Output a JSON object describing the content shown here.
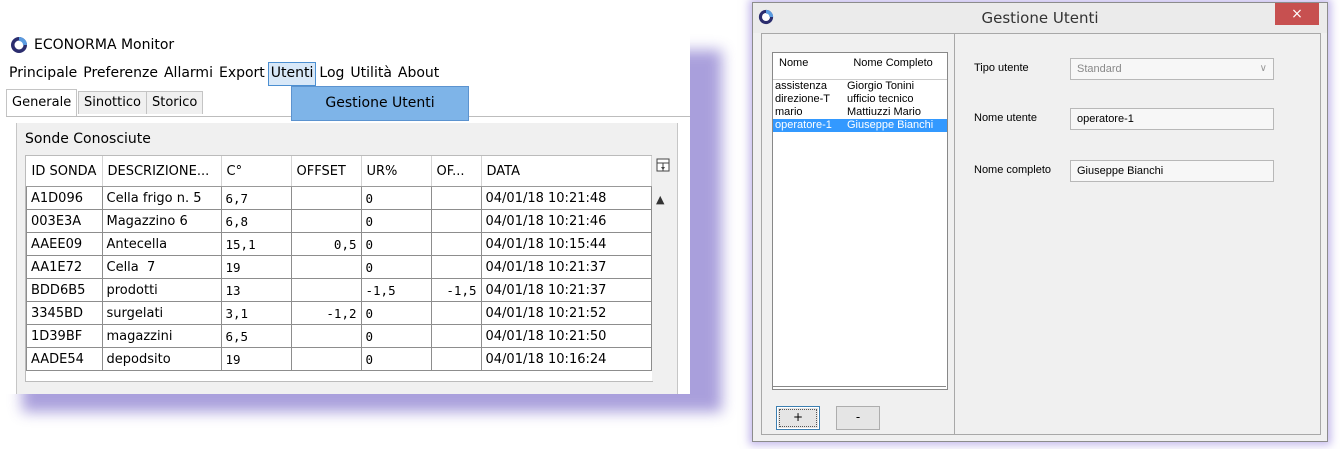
{
  "app": {
    "title": "ECONORMA Monitor"
  },
  "menu": [
    "Principale",
    "Preferenze",
    "Allarmi",
    "Export",
    "Utenti",
    "Log",
    "Utilità",
    "About"
  ],
  "tabs": [
    "Generale",
    "Sinottico",
    "Storico"
  ],
  "dropdown": {
    "item": "Gestione Utenti"
  },
  "panel": {
    "title": "Sonde Conosciute"
  },
  "grid": {
    "columns": [
      "ID SONDA",
      "DESCRIZIONE...",
      "C°",
      "OFFSET",
      "UR%",
      "OF...",
      "DATA"
    ],
    "rows": [
      [
        "A1D096",
        "Cella frigo n. 5",
        "6,7",
        "",
        "0",
        "",
        "04/01/18 10:21:48"
      ],
      [
        "003E3A",
        "Magazzino 6",
        "6,8",
        "",
        "0",
        "",
        "04/01/18 10:21:46"
      ],
      [
        "AAEE09",
        "Antecella",
        "15,1",
        "0,5",
        "0",
        "",
        "04/01/18 10:15:44"
      ],
      [
        "AA1E72",
        "Cella  7",
        "19",
        "",
        "0",
        "",
        "04/01/18 10:21:37"
      ],
      [
        "BDD6B5",
        "prodotti",
        "13",
        "",
        "-1,5",
        "-1,5",
        "04/01/18 10:21:37"
      ],
      [
        "3345BD",
        "surgelati",
        "3,1",
        "-1,2",
        "0",
        "",
        "04/01/18 10:21:52"
      ],
      [
        "1D39BF",
        "magazzini",
        "6,5",
        "",
        "0",
        "",
        "04/01/18 10:21:50"
      ],
      [
        "AADE54",
        "depodsito",
        "19",
        "",
        "0",
        "",
        "04/01/18 10:16:24"
      ]
    ]
  },
  "dialog": {
    "title": "Gestione Utenti",
    "close": "×",
    "list_headers": [
      "Nome",
      "Nome Completo"
    ],
    "users": [
      [
        "assistenza",
        "Giorgio Tonini"
      ],
      [
        "direzione-T",
        "ufficio tecnico"
      ],
      [
        "mario",
        "Mattiuzzi Mario"
      ],
      [
        "operatore-1",
        "Giuseppe Bianchi"
      ]
    ],
    "selected_user": "operatore-1",
    "add_label": "+",
    "remove_label": "-",
    "fields": {
      "tipo_label": "Tipo utente",
      "tipo_value": "Standard",
      "nome_label": "Nome utente",
      "nome_value": "operatore-1",
      "completo_label": "Nome completo",
      "completo_value": "Giuseppe Bianchi"
    }
  },
  "colors": {
    "accent": "#3399ff",
    "dropdown_bg": "#7eb4e8",
    "close_bg": "#c75050",
    "shadow": "#9b8fd6"
  },
  "icons": [
    "app-logo-icon",
    "column-chooser-icon",
    "scroll-up-icon",
    "combo-arrow-icon"
  ]
}
